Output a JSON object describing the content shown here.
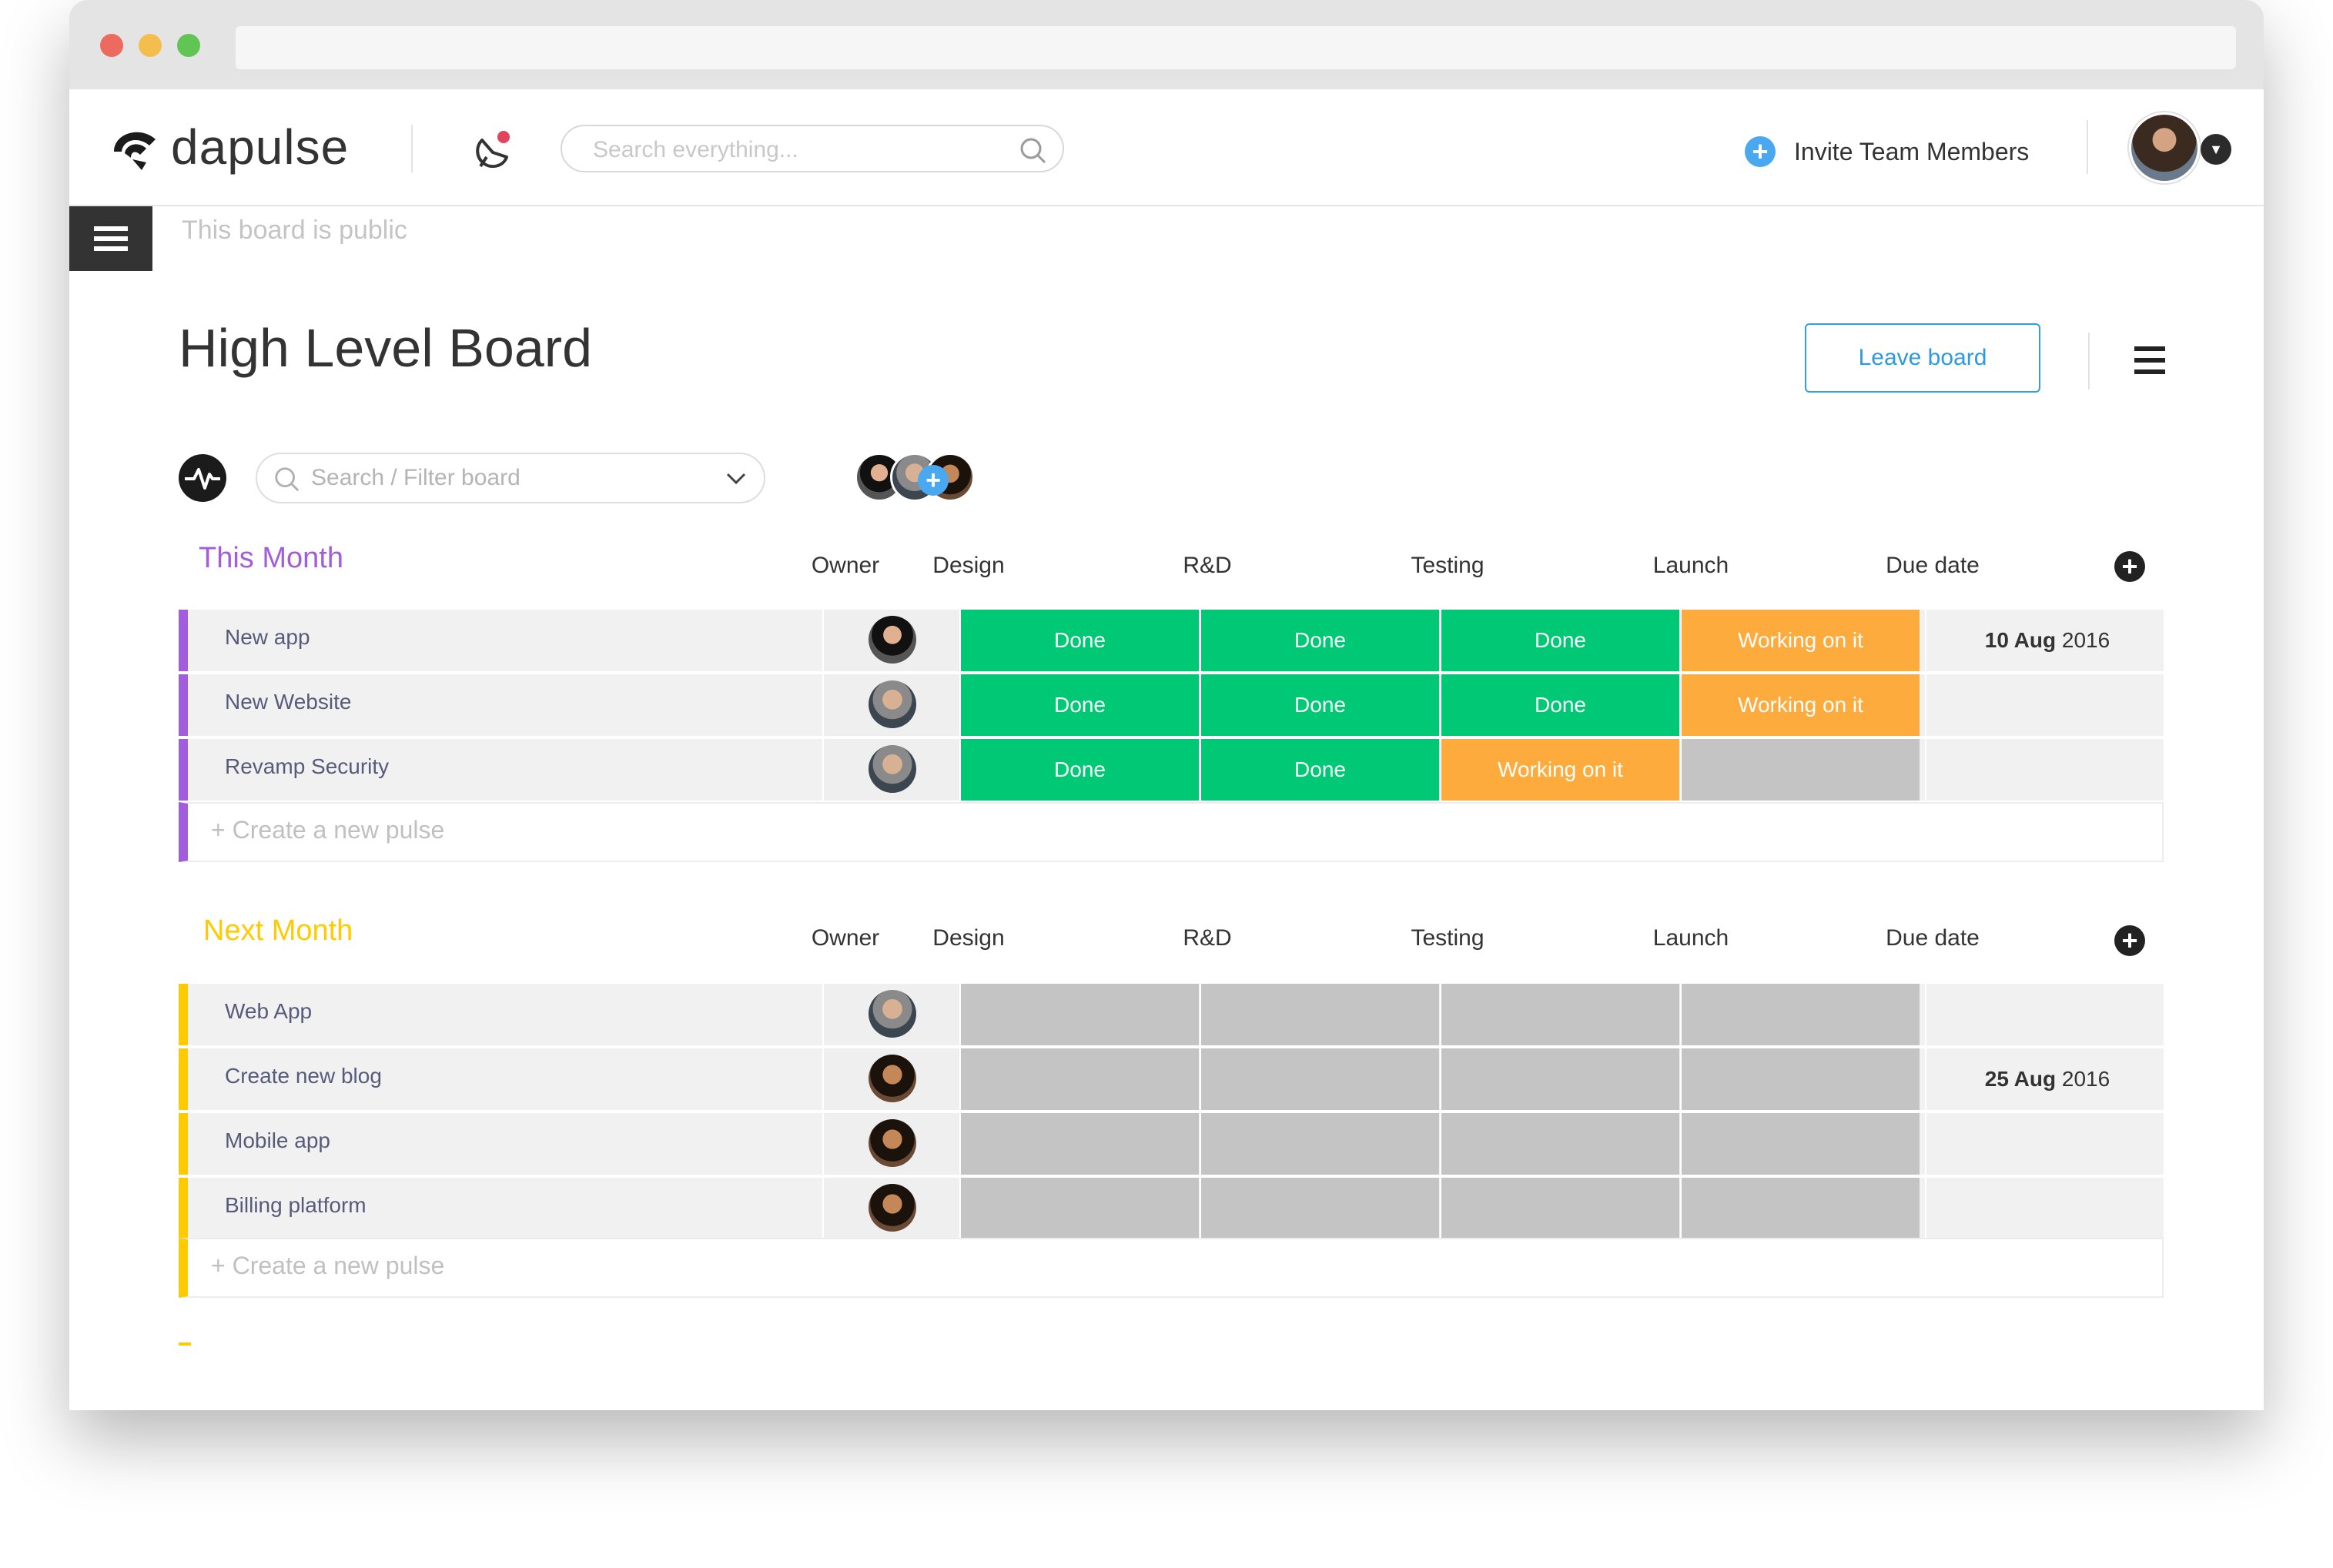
{
  "colors": {
    "done": "#00c875",
    "working": "#fdab3d",
    "empty": "#c4c4c4",
    "group_this_month": "#a25ddc",
    "group_next_month": "#ffcb00",
    "accent_blue": "#2d9ae0"
  },
  "app": {
    "logo_text": "dapulse",
    "search_placeholder": "Search everything...",
    "invite_label": "Invite Team Members"
  },
  "board": {
    "public_text": "This board is public",
    "title": "High Level Board",
    "leave_label": "Leave board",
    "filter_placeholder": "Search / Filter board"
  },
  "columns": [
    "Owner",
    "Design",
    "R&D",
    "Testing",
    "Launch",
    "Due date"
  ],
  "create_pulse_label": "+ Create a new pulse",
  "groups": [
    {
      "title": "This Month",
      "rows": [
        {
          "name": "New app",
          "design": "Done",
          "rnd": "Done",
          "testing": "Done",
          "launch": "Working on it",
          "due_day": "10 Aug",
          "due_year": "2016"
        },
        {
          "name": "New Website",
          "design": "Done",
          "rnd": "Done",
          "testing": "Done",
          "launch": "Working on it",
          "due_day": "",
          "due_year": ""
        },
        {
          "name": "Revamp Security",
          "design": "Done",
          "rnd": "Done",
          "testing": "Working on it",
          "launch": "",
          "due_day": "",
          "due_year": ""
        }
      ]
    },
    {
      "title": "Next Month",
      "rows": [
        {
          "name": "Web App",
          "due_day": "",
          "due_year": ""
        },
        {
          "name": "Create new blog",
          "due_day": "25 Aug",
          "due_year": "2016"
        },
        {
          "name": "Mobile app",
          "due_day": "",
          "due_year": ""
        },
        {
          "name": "Billing platform",
          "due_day": "",
          "due_year": ""
        }
      ]
    }
  ]
}
